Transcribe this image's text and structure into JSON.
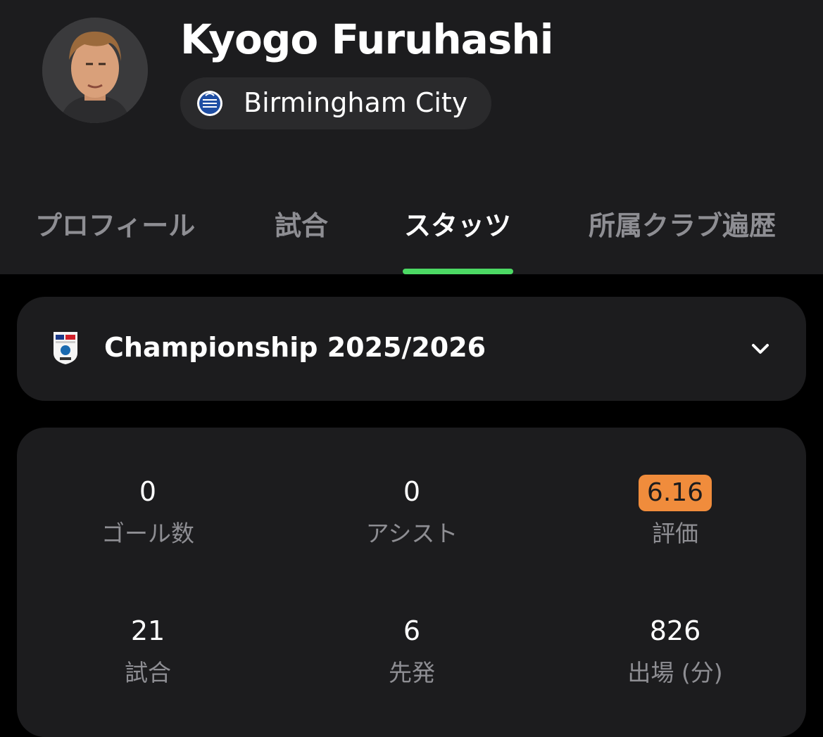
{
  "player": {
    "name": "Kyogo Furuhashi",
    "club": "Birmingham City",
    "avatar_icon": "player-photo",
    "club_crest_icon": "birmingham-city-crest"
  },
  "tabs": [
    {
      "label": "プロフィール",
      "active": false
    },
    {
      "label": "試合",
      "active": false
    },
    {
      "label": "スタッツ",
      "active": true
    },
    {
      "label": "所属クラブ遍歴",
      "active": false
    }
  ],
  "league_selector": {
    "name": "Championship 2025/2026",
    "logo_icon": "sky-bet-efl-championship-logo",
    "dropdown_icon": "chevron-down-icon"
  },
  "stats": [
    {
      "value": "0",
      "label": "ゴール数"
    },
    {
      "value": "0",
      "label": "アシスト"
    },
    {
      "value": "6.16",
      "label": "評価"
    },
    {
      "value": "21",
      "label": "試合"
    },
    {
      "value": "6",
      "label": "先発"
    },
    {
      "value": "826",
      "label": "出場 (分)"
    }
  ],
  "colors": {
    "background": "#000000",
    "surface": "#1c1c1e",
    "accent_green": "#4cd964",
    "rating_orange": "#f08c3c",
    "muted_text": "#8e8e93"
  }
}
